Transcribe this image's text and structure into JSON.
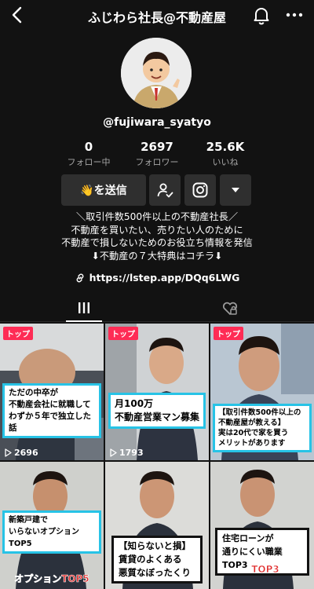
{
  "header": {
    "title": "ふじわら社長@不動産屋"
  },
  "profile": {
    "username": "@fujiwara_syatyo",
    "stats": [
      {
        "num": "0",
        "label": "フォロー中"
      },
      {
        "num": "2697",
        "label": "フォロワー"
      },
      {
        "num": "25.6K",
        "label": "いいね"
      }
    ],
    "send_button": "👋を送信",
    "bio_lines": [
      "＼取引件数500件以上の不動産社長／",
      "不動産を買いたい、売りたい人のために",
      "不動産で損しないためのお役立ち情報を発信",
      "⬇︎不動産の７大特典はコチラ⬇︎"
    ],
    "link": "https://lstep.app/DQq6LWG"
  },
  "videos": [
    {
      "badge": "トップ",
      "caption": "ただの中卒が\n不動産会社に就職して\nわずか５年で独立した話",
      "plays": "2696"
    },
    {
      "badge": "トップ",
      "caption": "月100万\n不動産営業マン募集",
      "plays": "1793"
    },
    {
      "badge": "トップ",
      "caption": "【取引件数500件以上の\n不動産屋が教える】\n実は20代で家を買う\nメリットがあります",
      "plays": ""
    },
    {
      "badge": "",
      "caption": "新築戸建で\nいらないオプションTOP5",
      "plays": "",
      "banner": "オプションTOP5"
    },
    {
      "badge": "",
      "caption": "【知らないと損】\n賃貸のよくある\n悪質なぼったくり",
      "plays": ""
    },
    {
      "badge": "",
      "caption": "住宅ローンが\n通りにくい職業TOP3",
      "plays": "",
      "banner": "TOP3"
    }
  ],
  "colors": {
    "background": "#121212",
    "button": "#2f2f2f",
    "badge": "#fe2c55",
    "caption_border": "#27c3e6"
  }
}
